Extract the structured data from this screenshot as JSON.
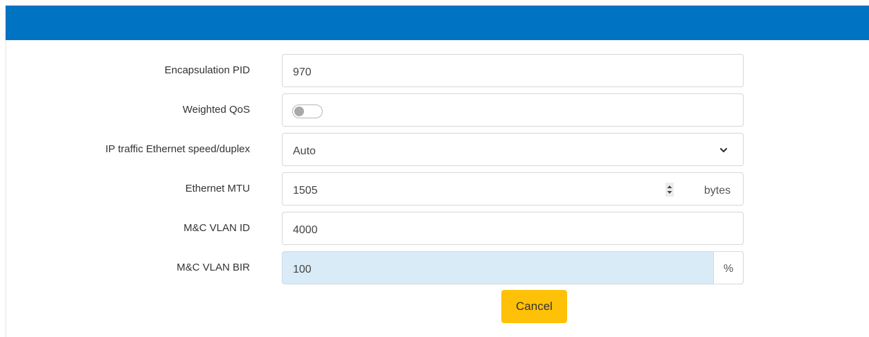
{
  "form": {
    "encapsulation_pid": {
      "label": "Encapsulation PID",
      "value": "970"
    },
    "weighted_qos": {
      "label": "Weighted QoS",
      "enabled": false
    },
    "ethernet_speed": {
      "label": "IP traffic Ethernet speed/duplex",
      "selected": "Auto"
    },
    "ethernet_mtu": {
      "label": "Ethernet MTU",
      "value": "1505",
      "unit": "bytes"
    },
    "mc_vlan_id": {
      "label": "M&C VLAN ID",
      "value": "4000"
    },
    "mc_vlan_bir": {
      "label": "M&C VLAN BIR",
      "value": "100",
      "unit": "%"
    }
  },
  "actions": {
    "cancel_label": "Cancel"
  },
  "colors": {
    "header": "#0074c2",
    "cancel_button": "#ffc107",
    "bir_highlight": "#d9ebf7"
  },
  "icons": {
    "select": "chevron-down-icon",
    "stepper": "spinner-updown-icon"
  }
}
